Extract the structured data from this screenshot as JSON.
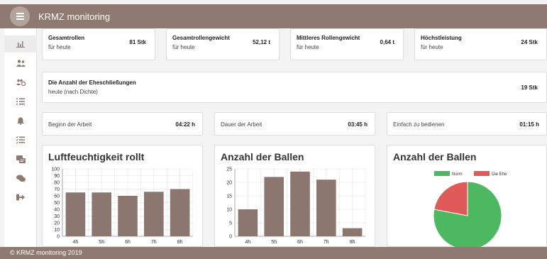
{
  "app": {
    "title": "KRMZ monitoring"
  },
  "sidebar": {
    "items": [
      {
        "icon": "bar-chart-icon"
      },
      {
        "icon": "users-icon"
      },
      {
        "icon": "user-settings-icon"
      },
      {
        "icon": "list-ordered-icon"
      },
      {
        "icon": "bell-icon"
      },
      {
        "icon": "task-list-icon"
      },
      {
        "icon": "user-card-icon"
      },
      {
        "icon": "chat-icon"
      },
      {
        "icon": "logout-icon"
      }
    ]
  },
  "stats": [
    {
      "title": "Gesamtrollen",
      "subtitle": "für heute",
      "value": "81 Stk"
    },
    {
      "title": "Gesamtrollengewicht",
      "subtitle": "für heute",
      "value": "52,12 t"
    },
    {
      "title": "Mittleres Rollengewicht",
      "subtitle": "für heute",
      "value": "0,64 t"
    },
    {
      "title": "Höchstleistung",
      "subtitle": "für heute",
      "value": "24 Stk"
    }
  ],
  "wide_stat": {
    "title": "Die Anzahl der Eheschließungen",
    "subtitle": "heute (nach Dichte)",
    "value": "19 Stk"
  },
  "times": [
    {
      "label": "Beginn der Arbeit",
      "value": "04:22 h"
    },
    {
      "label": "Dauer der Arbeit",
      "value": "03:45 h"
    },
    {
      "label": "Einfach zu bedienen",
      "value": "01:15 h"
    }
  ],
  "colors": {
    "header": "#8f7a72",
    "bar": "#8c7670",
    "pie_norm": "#4cb860",
    "pie_ehe": "#e05a5a"
  },
  "chart_data": [
    {
      "type": "bar",
      "title": "Luftfeuchtigkeit rollt",
      "categories": [
        "4h",
        "5h",
        "6h",
        "7h",
        "8h"
      ],
      "values": [
        65,
        65,
        60,
        66,
        70
      ],
      "ylim": [
        0,
        100
      ],
      "yticks": [
        0,
        10,
        20,
        30,
        40,
        50,
        60,
        70,
        80,
        90,
        100
      ],
      "grid": true
    },
    {
      "type": "bar",
      "title": "Anzahl der Ballen",
      "categories": [
        "4h",
        "5h",
        "6h",
        "7h",
        "8h"
      ],
      "values": [
        10,
        22,
        24,
        21,
        3
      ],
      "ylim": [
        0,
        25
      ],
      "yticks": [
        0,
        5,
        10,
        15,
        20,
        25
      ],
      "grid": true
    },
    {
      "type": "pie",
      "title": "Anzahl der Ballen",
      "labels": [
        "Norm",
        "Die Ehe"
      ],
      "values": [
        78,
        22
      ],
      "legend": "top"
    }
  ],
  "footer": {
    "text": "© KRMZ monitoring 2019"
  }
}
